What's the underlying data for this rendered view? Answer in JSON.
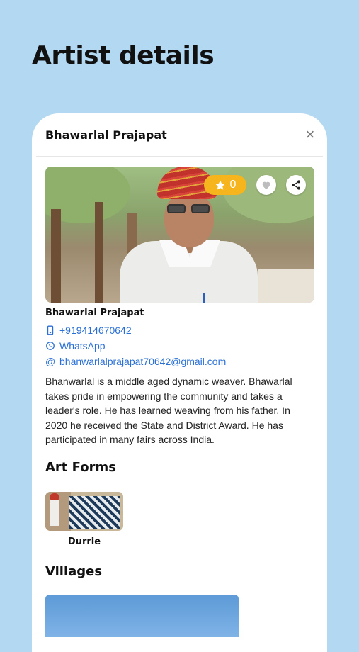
{
  "page": {
    "heading": "Artist details"
  },
  "modal": {
    "title": "Bhawarlal Prajapat",
    "close_icon": "×"
  },
  "hero": {
    "rating_count": "0",
    "rating_icon": "star-icon",
    "like_icon": "heart-icon",
    "share_icon": "share-icon"
  },
  "artist": {
    "name": "Bhawarlal Prajapat",
    "phone": "+919414670642",
    "whatsapp_label": "WhatsApp",
    "email_prefix": "@",
    "email": "bhanwarlalprajapat70642@gmail.com",
    "bio": "Bhanwarlal is a middle aged dynamic weaver. Bhawarlal takes pride in empowering the community and takes a leader's role. He has learned weaving from his father. In 2020 he received the State and District Award. He has participated in many fairs across India."
  },
  "sections": {
    "art_forms_title": "Art Forms",
    "villages_title": "Villages"
  },
  "art_forms": [
    {
      "label": "Durrie"
    }
  ],
  "colors": {
    "background": "#b3d8f2",
    "accent_link": "#2a6fd6",
    "rating_pill": "#f6b51c"
  }
}
